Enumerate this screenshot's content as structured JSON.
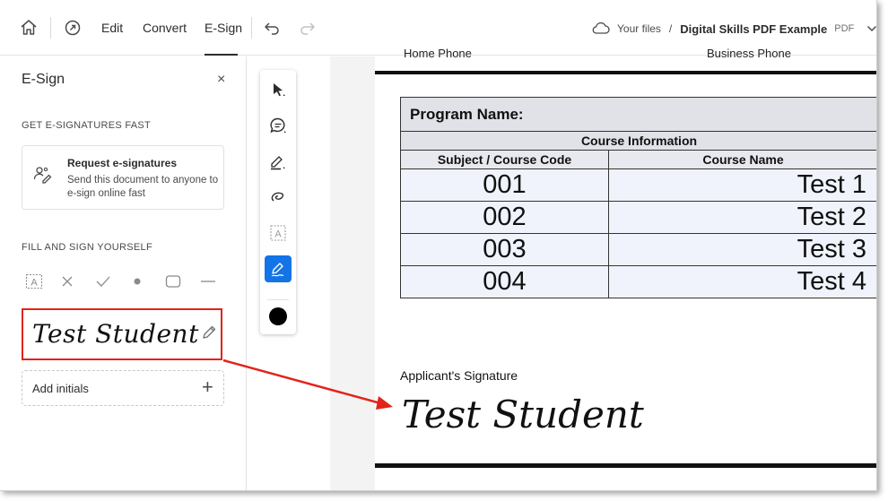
{
  "toolbar": {
    "tabs": [
      "Edit",
      "Convert",
      "E-Sign"
    ],
    "active_tab": "E-Sign",
    "breadcrumb_root": "Your files",
    "breadcrumb_sep": "/",
    "file_name": "Digital Skills PDF Example",
    "file_type": "PDF"
  },
  "esign_panel": {
    "title": "E-Sign",
    "close_label": "×",
    "section1": "GET E-SIGNATURES FAST",
    "request_title": "Request e-signatures",
    "request_desc": "Send this document to anyone to e-sign online fast",
    "section2": "FILL AND SIGN YOURSELF",
    "fill_tools": [
      "text-field-icon",
      "cross-mark-icon",
      "checkmark-icon",
      "dot-icon",
      "rectangle-icon",
      "line-icon"
    ],
    "saved_signature": "Test Student",
    "add_initials": "Add initials",
    "add_initials_plus": "+"
  },
  "vertical_toolbar": {
    "tools": [
      "select-arrow-icon",
      "comment-icon",
      "highlight-icon",
      "draw-lasso-icon",
      "text-box-icon",
      "sign-pen-icon"
    ],
    "active_tool": "sign-pen-icon",
    "color": "#000000"
  },
  "document": {
    "cut_labels": [
      "Home Phone",
      "Business Phone"
    ],
    "program_label": "Program Name:",
    "course_info_label": "Course Information",
    "columns": [
      "Subject / Course Code",
      "Course Name"
    ],
    "rows": [
      {
        "code": "001",
        "name": "Test 1"
      },
      {
        "code": "002",
        "name": "Test 2"
      },
      {
        "code": "003",
        "name": "Test 3"
      },
      {
        "code": "004",
        "name": "Test 4"
      }
    ],
    "signature_label": "Applicant's Signature",
    "signature_value": "Test Student"
  },
  "colors": {
    "highlight_red": "#e2231a",
    "accent_blue": "#1473e6"
  }
}
